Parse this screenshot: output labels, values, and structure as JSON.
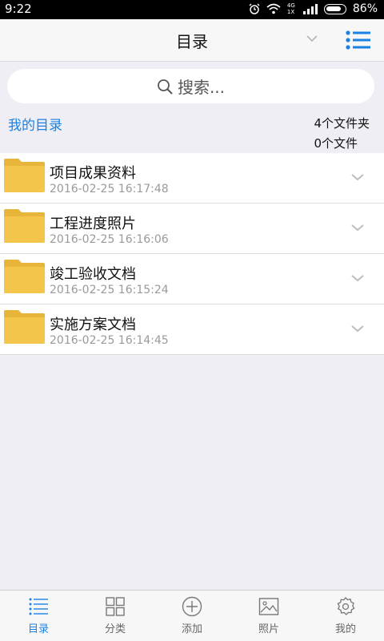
{
  "status_bar": {
    "time": "9:22",
    "network_label": "4G 1X",
    "battery": "86%",
    "icons": [
      "alarm-icon",
      "wifi-icon",
      "signal-icon",
      "battery-icon"
    ]
  },
  "header": {
    "title": "目录",
    "icons": [
      "chevron-down-icon",
      "list-menu-icon"
    ]
  },
  "search": {
    "placeholder": "搜索..."
  },
  "summary": {
    "my_directory": "我的目录",
    "folder_count": "4个文件夹",
    "file_count": "0个文件"
  },
  "folders": [
    {
      "name": "项目成果资料",
      "date": "2016-02-25 16:17:48"
    },
    {
      "name": "工程进度照片",
      "date": "2016-02-25 16:16:06"
    },
    {
      "name": "竣工验收文档",
      "date": "2016-02-25 16:15:24"
    },
    {
      "name": "实施方案文档",
      "date": "2016-02-25 16:14:45"
    }
  ],
  "tabs": [
    {
      "label": "目录",
      "icon": "list-icon",
      "active": true
    },
    {
      "label": "分类",
      "icon": "grid-icon",
      "active": false
    },
    {
      "label": "添加",
      "icon": "plus-circle-icon",
      "active": false
    },
    {
      "label": "照片",
      "icon": "photo-icon",
      "active": false
    },
    {
      "label": "我的",
      "icon": "gear-icon",
      "active": false
    }
  ],
  "colors": {
    "accent": "#1a82e4",
    "folder": "#f3c54a",
    "background": "#eeeef4"
  }
}
